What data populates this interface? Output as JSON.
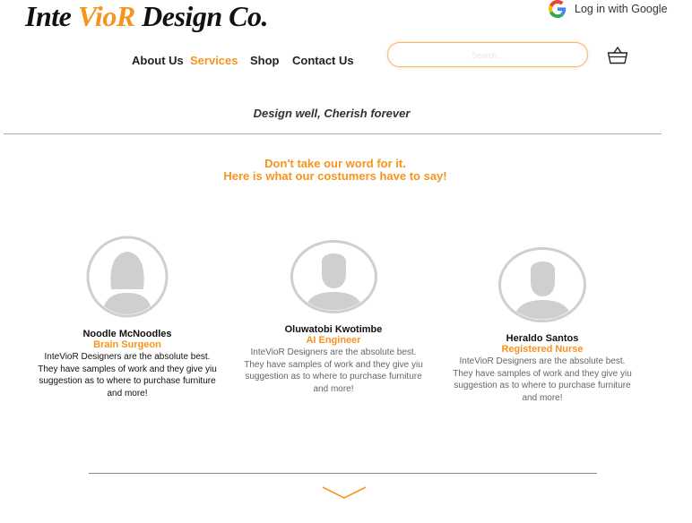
{
  "header": {
    "logo": {
      "part1": "Inte ",
      "part2": "Vio",
      "part3": "R",
      "part4": " Design Co."
    },
    "google_login_label": "Log in with Google",
    "nav": [
      "About Us",
      "Services",
      "Shop",
      "Contact Us"
    ],
    "active_nav": "Services",
    "search_placeholder": "Search..."
  },
  "tagline": "Design well, Cherish forever",
  "intro": {
    "line1": "Don't take our word for it.",
    "line2": "Here is what our costumers have to say!"
  },
  "testimonials": [
    {
      "name": "Noodle McNoodles",
      "role": "Brain Surgeon",
      "quote": "InteVioR Designers are the absolute best. They have samples of work and they give yiu suggestion as to where to purchase furniture and more!",
      "avatar_icon": "female-avatar-icon"
    },
    {
      "name": "Oluwatobi Kwotimbe",
      "role": "AI Engineer",
      "quote": "InteVioR Designers are the absolute best. They have samples of work and they give yiu suggestion as to where to purchase furniture and more!",
      "avatar_icon": "male-avatar-icon"
    },
    {
      "name": "Heraldo Santos",
      "role": "Registered Nurse",
      "quote": "InteVioR Designers are the absolute best. They have samples of work and they give yiu suggestion as to where to purchase furniture and more!",
      "avatar_icon": "male-avatar-icon"
    }
  ],
  "colors": {
    "accent": "#f7941d",
    "avatar_grey": "#cfcfcf"
  }
}
